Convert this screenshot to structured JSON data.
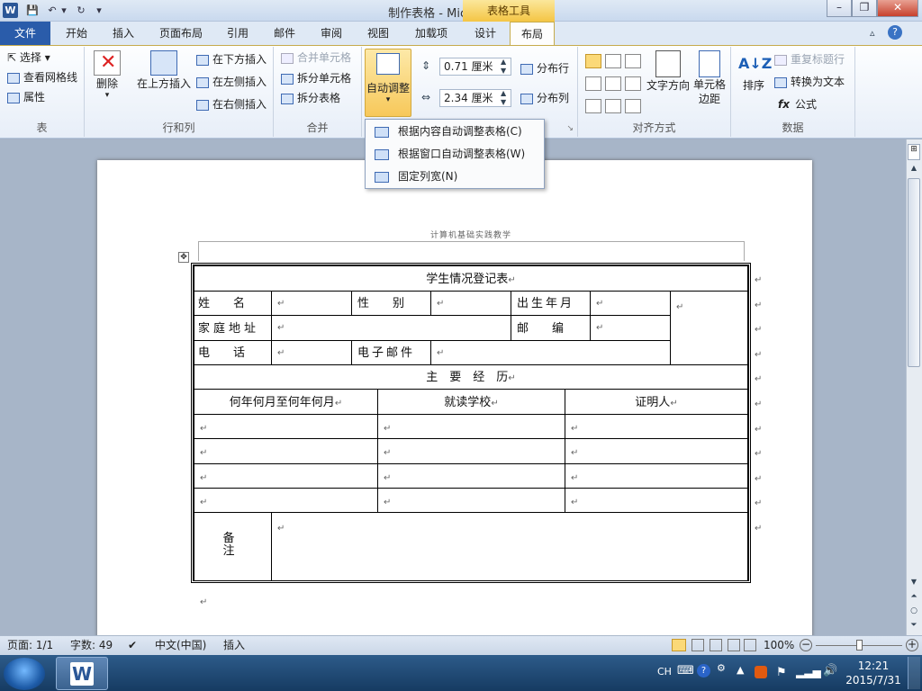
{
  "window": {
    "title": "制作表格 - Microsoft Word",
    "context_tab_group": "表格工具",
    "minimize": "–",
    "restore": "❐",
    "close": "✕"
  },
  "tabs": {
    "file": "文件",
    "home": "开始",
    "insert": "插入",
    "page_layout": "页面布局",
    "references": "引用",
    "mailings": "邮件",
    "review": "审阅",
    "view": "视图",
    "addins": "加载项",
    "design": "设计",
    "layout": "布局"
  },
  "ribbon": {
    "table": {
      "label": "表",
      "select": "选择",
      "view_gridlines": "查看网格线",
      "properties": "属性"
    },
    "rows_cols": {
      "label": "行和列",
      "delete": "删除",
      "insert_above": "在上方插入",
      "insert_below": "在下方插入",
      "insert_left": "在左侧插入",
      "insert_right": "在右侧插入"
    },
    "merge": {
      "label": "合并",
      "merge_cells": "合并单元格",
      "split_cells": "拆分单元格",
      "split_table": "拆分表格"
    },
    "cell_size": {
      "autofit": "自动调整",
      "height_value": "0.71 厘米",
      "width_value": "2.34 厘米",
      "distribute_rows": "分布行",
      "distribute_cols": "分布列"
    },
    "alignment": {
      "label": "对齐方式",
      "text_direction": "文字方向",
      "cell_margins": "单元格\n边距"
    },
    "data": {
      "label": "数据",
      "sort": "排序",
      "repeat_header": "重复标题行",
      "convert_to_text": "转换为文本",
      "formula": "公式"
    }
  },
  "autofit_menu": {
    "items": [
      "根据内容自动调整表格(C)",
      "根据窗口自动调整表格(W)",
      "固定列宽(N)"
    ]
  },
  "document": {
    "header_text": "计算机基础实践教学",
    "table_title": "学生情况登记表",
    "name_label": "姓　　名",
    "gender_label": "性　　别",
    "birth_label": "出生年月",
    "address_label": "家庭地址",
    "postcode_label": "邮　　编",
    "phone_label": "电　　话",
    "email_label": "电子邮件",
    "experience_title": "主　要　经　历",
    "col_period": "何年何月至何年何月",
    "col_school": "就读学校",
    "col_witness": "证明人",
    "remarks_label": "备注"
  },
  "status": {
    "page": "页面: 1/1",
    "words": "字数: 49",
    "language": "中文(中国)",
    "mode": "插入",
    "zoom": "100%"
  },
  "taskbar": {
    "ime": "CH",
    "time": "12:21",
    "date": "2015/7/31"
  }
}
